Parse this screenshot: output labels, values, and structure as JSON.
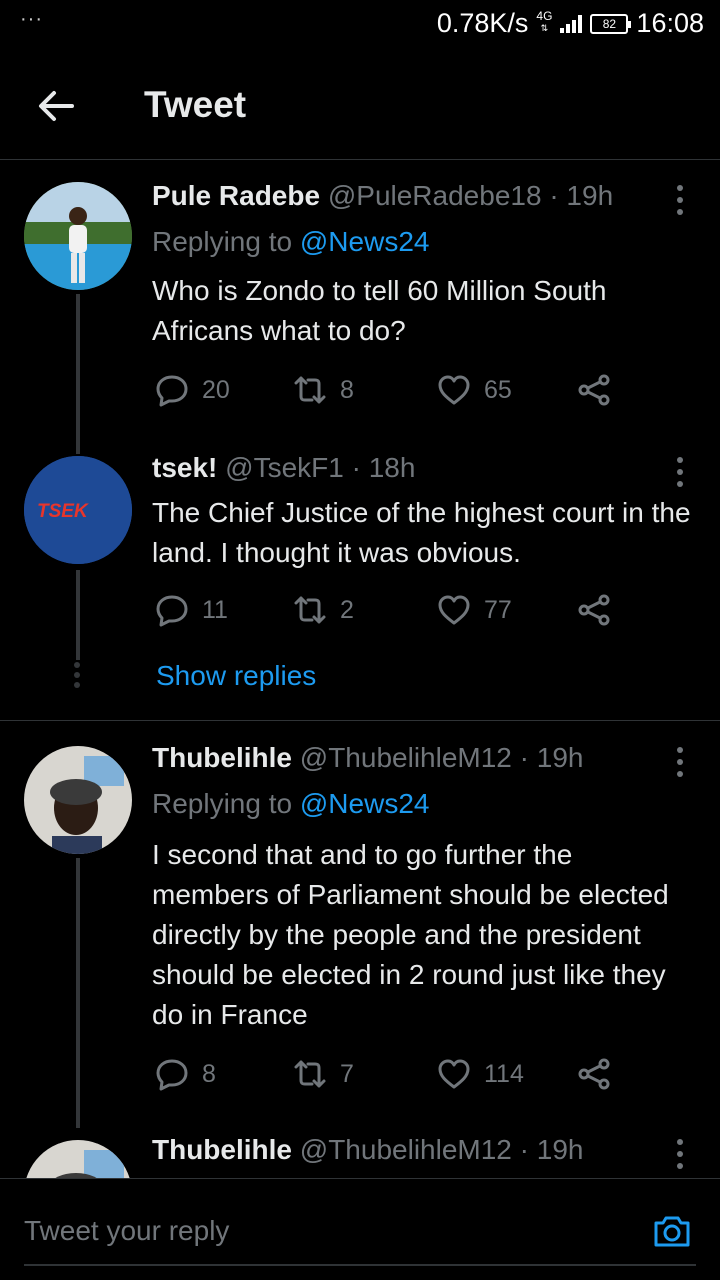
{
  "status_bar": {
    "dots": "···",
    "net_speed": "0.78K/s",
    "network_type": "4G",
    "battery": "82",
    "time": "16:08"
  },
  "header": {
    "title": "Tweet"
  },
  "tweets": [
    {
      "name": "Pule Radebe",
      "handle": "@PuleRadebe18 · 19h",
      "replying_prefix": "Replying to",
      "replying_to": "@News24",
      "text": "Who is Zondo to tell 60 Million South Africans what to do?",
      "replies": "20",
      "retweets": "8",
      "likes": "65"
    },
    {
      "name": "tsek!",
      "handle": "@TsekF1 · 18h",
      "text": "The Chief Justice of the highest court in the land. I thought it was obvious.",
      "replies": "11",
      "retweets": "2",
      "likes": "77",
      "avatar_text": "TSEK"
    },
    {
      "name": "Thubelihle",
      "handle": "@ThubelihleM12 · 19h",
      "replying_prefix": "Replying to",
      "replying_to": "@News24",
      "text": "I second that and to go further the members of Parliament should be elected directly by the people and the president should be elected in 2 round just like they do in France",
      "replies": "8",
      "retweets": "7",
      "likes": "114"
    },
    {
      "name": "Thubelihle",
      "handle": "@ThubelihleM12 · 19h"
    }
  ],
  "show_replies": "Show replies",
  "reply_bar": {
    "placeholder": "Tweet your reply"
  },
  "colors": {
    "accent": "#1d9bf0",
    "muted": "#71767b",
    "background": "#000000"
  }
}
